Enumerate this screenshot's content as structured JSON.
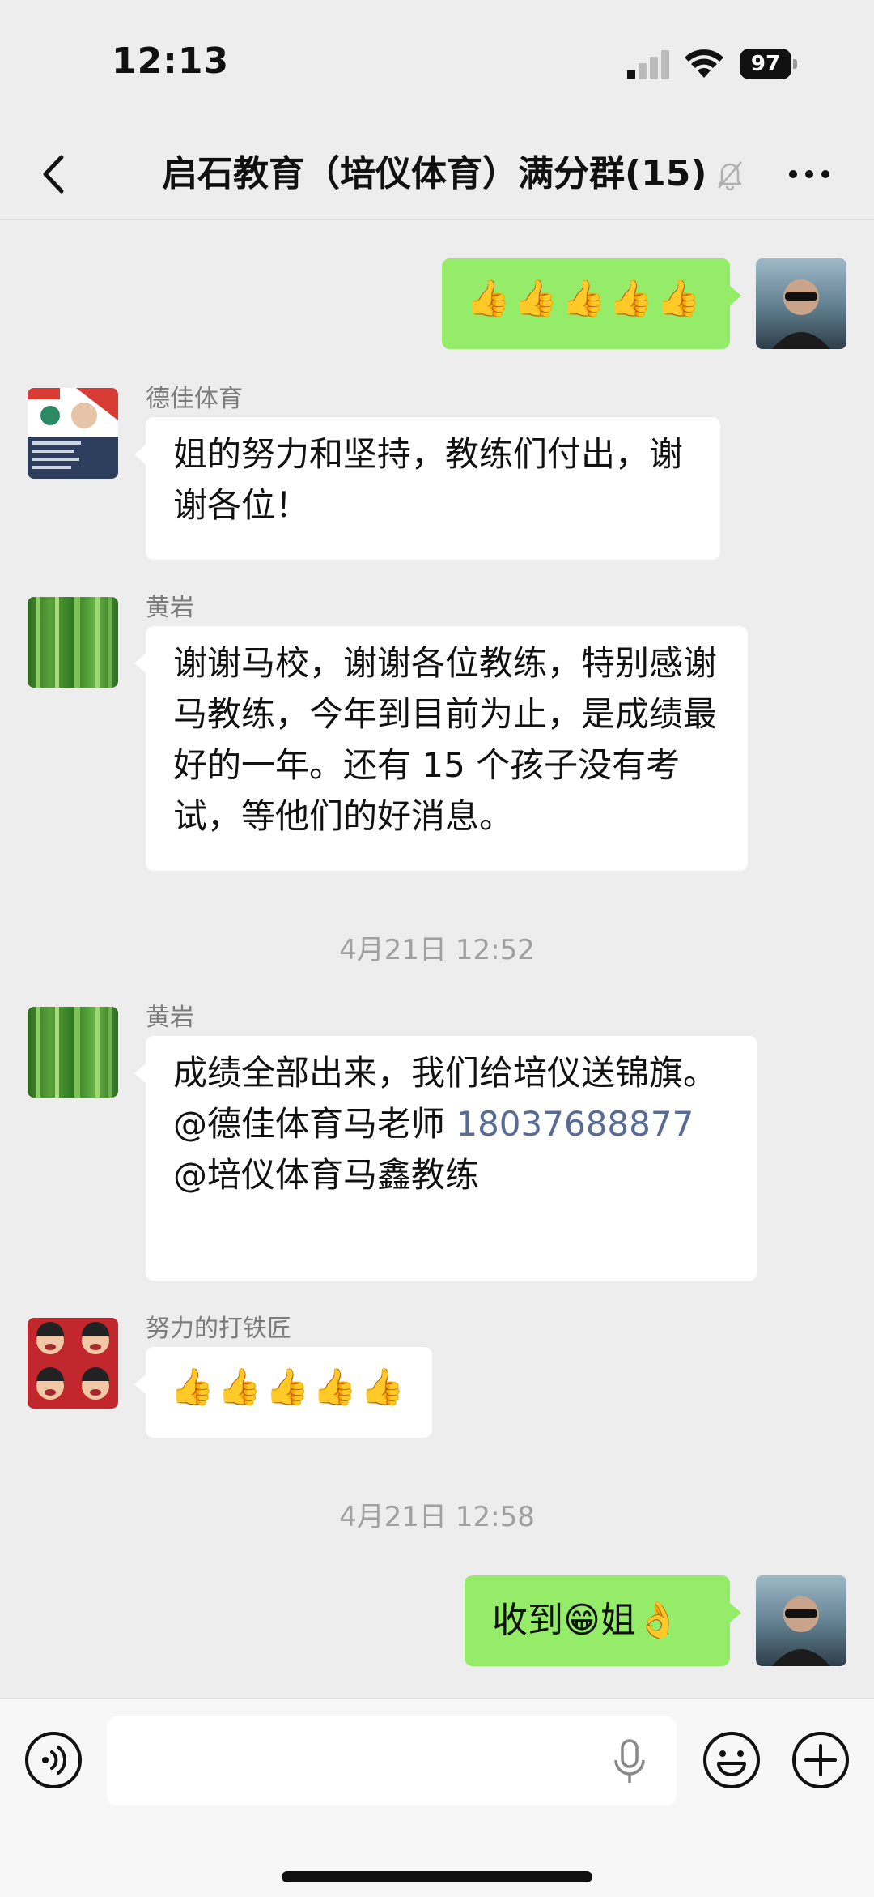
{
  "status_bar": {
    "time": "12:13",
    "battery": "97"
  },
  "header": {
    "title": "启石教育（培仪体育）满分群(15)"
  },
  "messages": [
    {
      "side": "out",
      "emoji": [
        "👍",
        "👍",
        "👍",
        "👍",
        "👍"
      ]
    },
    {
      "side": "in",
      "sender": "德佳体育",
      "text": "姐的努力和坚持，教练们付出，谢谢各位！"
    },
    {
      "side": "in",
      "sender": "黄岩",
      "text": "谢谢马校，谢谢各位教练，特别感谢马教练，今年到目前为止，是成绩最好的一年。还有 15 个孩子没有考试，等他们的好消息。"
    },
    {
      "type": "time",
      "text": "4月21日 12:52"
    },
    {
      "side": "in",
      "sender": "黄岩",
      "text_before": "成绩全部出来，我们给培仪送锦旗。@德佳体育马老师 ",
      "phone": "18037688877",
      "text_after": " @培仪体育马鑫教练"
    },
    {
      "side": "in",
      "sender": "努力的打铁匠",
      "emoji": [
        "👍",
        "👍",
        "👍",
        "👍",
        "👍"
      ]
    },
    {
      "type": "time",
      "text": "4月21日 12:58"
    },
    {
      "side": "out",
      "text_before": "收到",
      "emoji_mid": "😁",
      "text_after": "姐",
      "emoji_end": "👌"
    }
  ],
  "colors": {
    "background": "#ededed",
    "out_bubble": "#95ec69",
    "in_bubble": "#ffffff",
    "link": "#576b95"
  }
}
